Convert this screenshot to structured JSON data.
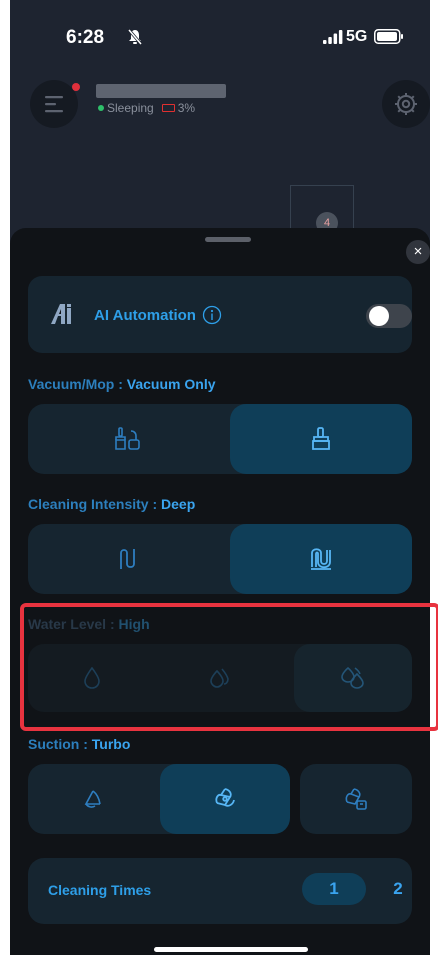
{
  "status_bar": {
    "time": "6:28",
    "network": "5G"
  },
  "device": {
    "status": "Sleeping",
    "battery": "3%"
  },
  "map": {
    "room_badge": "4"
  },
  "sheet": {
    "close_glyph": "×",
    "ai_automation": {
      "label": "AI Automation",
      "enabled": false
    },
    "vacuum_mop": {
      "title": "Vacuum/Mop :",
      "value": "Vacuum Only",
      "options": [
        "vacuum-and-mop-icon",
        "vacuum-only-icon"
      ],
      "selected_index": 1
    },
    "cleaning_intensity": {
      "title": "Cleaning Intensity :",
      "value": "Deep",
      "options": [
        "standard-path-icon",
        "deep-path-icon"
      ],
      "selected_index": 1
    },
    "water_level": {
      "title": "Water Level :",
      "value": "High",
      "disabled": true,
      "options": [
        "water-low-icon",
        "water-medium-icon",
        "water-high-icon"
      ],
      "selected_index": 2
    },
    "suction": {
      "title": "Suction :",
      "value": "Turbo",
      "options": [
        "suction-quiet-icon",
        "suction-turbo-icon",
        "suction-max-icon"
      ],
      "selected_index": 1
    },
    "cleaning_times": {
      "label": "Cleaning Times",
      "options": [
        "1",
        "2"
      ],
      "selected_index": 0
    }
  },
  "colors": {
    "accent": "#2e9fe8",
    "selected_segment": "#0f3e58",
    "highlight_box": "#e8333f",
    "sheet_bg": "#101317"
  }
}
